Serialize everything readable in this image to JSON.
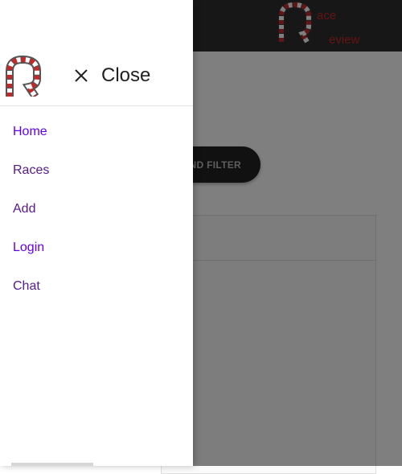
{
  "app": {
    "brand_letters_top": "ace",
    "brand_letters_bottom": "eview",
    "brand_color": "#c62828"
  },
  "background": {
    "filter_button_label": "AND FILTER"
  },
  "drawer": {
    "close_label": "Close",
    "nav_items": [
      {
        "label": "Home"
      },
      {
        "label": "Races"
      },
      {
        "label": "Add"
      },
      {
        "label": "Login"
      },
      {
        "label": "Chat"
      }
    ]
  },
  "icons": {
    "close": "close-icon",
    "logo": "race-track-logo-icon"
  },
  "colors": {
    "link": "#6200ee",
    "visited_link": "#551a8b",
    "topbar": "#2e2e2e"
  }
}
